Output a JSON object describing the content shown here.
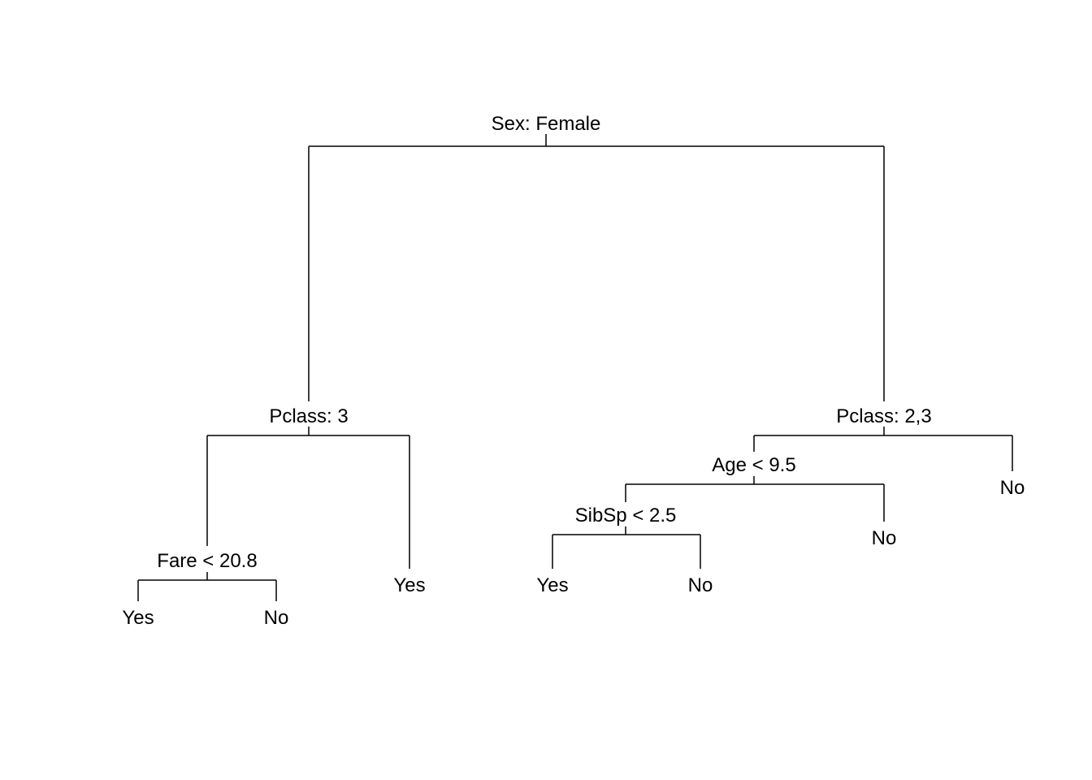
{
  "tree": {
    "root_label": "Sex: Female",
    "left": {
      "label": "Pclass: 3",
      "left": {
        "label": "Fare < 20.8",
        "left_leaf": "Yes",
        "right_leaf": "No"
      },
      "right_leaf": "Yes"
    },
    "right": {
      "label": "Pclass: 2,3",
      "left": {
        "label": "Age < 9.5",
        "left": {
          "label": "SibSp < 2.5",
          "left_leaf": "Yes",
          "right_leaf": "No"
        },
        "right_leaf": "No"
      },
      "right_leaf": "No"
    }
  }
}
